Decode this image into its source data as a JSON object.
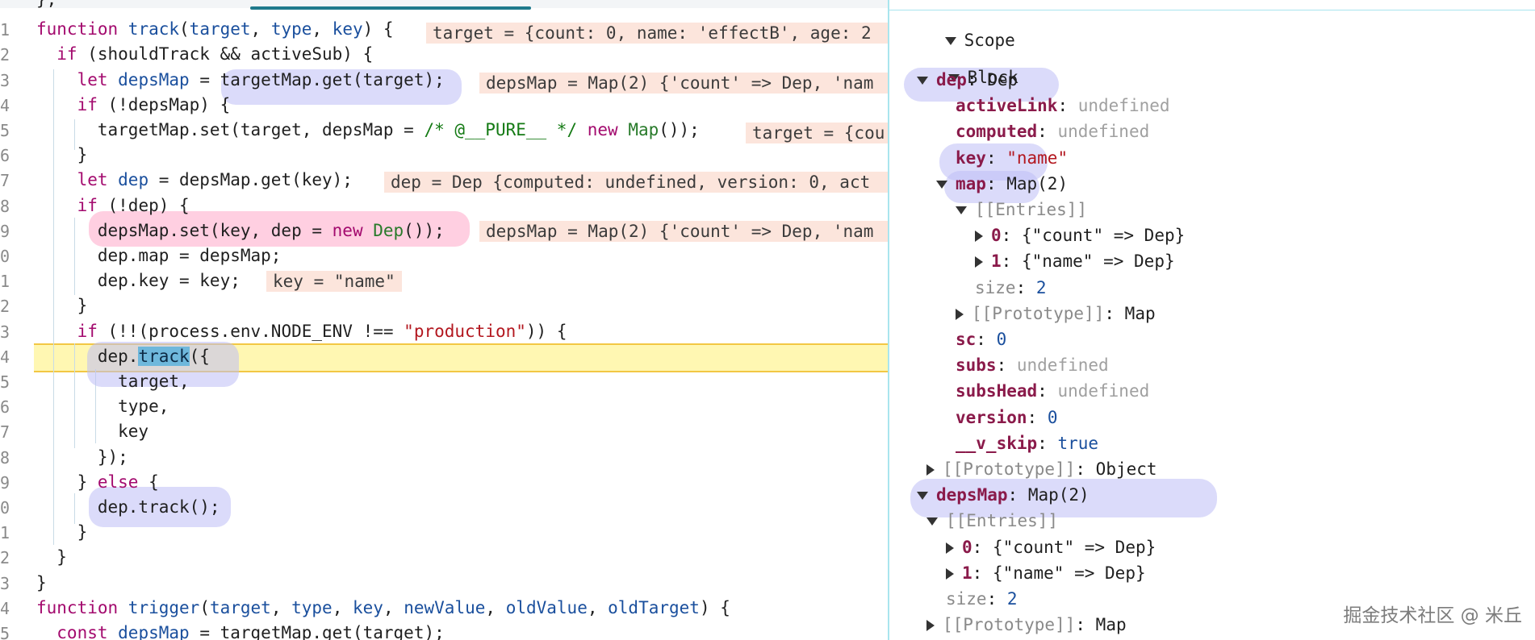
{
  "editor": {
    "gutter": [
      "1",
      "2",
      "3",
      "4",
      "5",
      "6",
      "7",
      "8",
      "9",
      "0",
      "1",
      "2",
      "3",
      "4",
      "5",
      "6",
      "7",
      "8",
      "9",
      "0",
      "1",
      "2",
      "3",
      "4",
      "5"
    ],
    "lines": [
      {
        "top": "",
        "segments": []
      },
      {
        "segments": [
          {
            "t": "function ",
            "c": "kw"
          },
          {
            "t": "track",
            "c": "fn"
          },
          {
            "t": "(",
            "c": ""
          },
          {
            "t": "target",
            "c": "fn"
          },
          {
            "t": ", ",
            "c": ""
          },
          {
            "t": "type",
            "c": "fn"
          },
          {
            "t": ", ",
            "c": ""
          },
          {
            "t": "key",
            "c": "fn"
          },
          {
            "t": ") {",
            "c": ""
          }
        ]
      },
      {
        "segments": [
          {
            "t": "  if ",
            "c": "kw"
          },
          {
            "t": "(shouldTrack && activeSub) {",
            "c": ""
          }
        ]
      },
      {
        "segments": [
          {
            "t": "    let ",
            "c": "kw"
          },
          {
            "t": "depsMap",
            "c": "fn"
          },
          {
            "t": " = targetMap.get(target);",
            "c": ""
          }
        ]
      },
      {
        "segments": [
          {
            "t": "    if ",
            "c": "kw"
          },
          {
            "t": "(!depsMap) {",
            "c": ""
          }
        ]
      },
      {
        "segments": [
          {
            "t": "      targetMap.set(target, depsMap = ",
            "c": ""
          },
          {
            "t": "/* @__PURE__ */",
            "c": "cmt"
          },
          {
            "t": " new ",
            "c": "kw"
          },
          {
            "t": "Map",
            "c": "cls"
          },
          {
            "t": "());",
            "c": ""
          }
        ]
      },
      {
        "segments": [
          {
            "t": "    }",
            "c": ""
          }
        ]
      },
      {
        "segments": [
          {
            "t": "    let ",
            "c": "kw"
          },
          {
            "t": "dep",
            "c": "fn"
          },
          {
            "t": " = depsMap.get(key);",
            "c": ""
          }
        ]
      },
      {
        "segments": [
          {
            "t": "    if ",
            "c": "kw"
          },
          {
            "t": "(!dep) {",
            "c": ""
          }
        ]
      },
      {
        "segments": [
          {
            "t": "      depsMap.set(key, dep = ",
            "c": ""
          },
          {
            "t": "new ",
            "c": "kw"
          },
          {
            "t": "Dep",
            "c": "cls"
          },
          {
            "t": "());",
            "c": ""
          }
        ]
      },
      {
        "segments": [
          {
            "t": "      dep.map = depsMap;",
            "c": ""
          }
        ]
      },
      {
        "segments": [
          {
            "t": "      dep.key = key;",
            "c": ""
          }
        ]
      },
      {
        "segments": [
          {
            "t": "    }",
            "c": ""
          }
        ]
      },
      {
        "segments": [
          {
            "t": "    if ",
            "c": "kw"
          },
          {
            "t": "(!!(process.env.NODE_ENV !== ",
            "c": ""
          },
          {
            "t": "\"production\"",
            "c": "str"
          },
          {
            "t": ")) {",
            "c": ""
          }
        ]
      },
      {
        "segments": [
          {
            "t": "      dep.",
            "c": ""
          },
          {
            "t": "track",
            "c": "sel"
          },
          {
            "t": "({",
            "c": ""
          }
        ]
      },
      {
        "segments": [
          {
            "t": "        target,",
            "c": ""
          }
        ]
      },
      {
        "segments": [
          {
            "t": "        type,",
            "c": ""
          }
        ]
      },
      {
        "segments": [
          {
            "t": "        key",
            "c": ""
          }
        ]
      },
      {
        "segments": [
          {
            "t": "      });",
            "c": ""
          }
        ]
      },
      {
        "segments": [
          {
            "t": "    } ",
            "c": ""
          },
          {
            "t": "else ",
            "c": "kw"
          },
          {
            "t": "{",
            "c": ""
          }
        ]
      },
      {
        "segments": [
          {
            "t": "      dep.track();",
            "c": ""
          }
        ]
      },
      {
        "segments": [
          {
            "t": "    }",
            "c": ""
          }
        ]
      },
      {
        "segments": [
          {
            "t": "  }",
            "c": ""
          }
        ]
      },
      {
        "segments": [
          {
            "t": "}",
            "c": ""
          }
        ]
      },
      {
        "segments": [
          {
            "t": "function ",
            "c": "kw"
          },
          {
            "t": "trigger",
            "c": "fn"
          },
          {
            "t": "(",
            "c": ""
          },
          {
            "t": "target",
            "c": "fn"
          },
          {
            "t": ", ",
            "c": ""
          },
          {
            "t": "type",
            "c": "fn"
          },
          {
            "t": ", ",
            "c": ""
          },
          {
            "t": "key",
            "c": "fn"
          },
          {
            "t": ", ",
            "c": ""
          },
          {
            "t": "newValue",
            "c": "fn"
          },
          {
            "t": ", ",
            "c": ""
          },
          {
            "t": "oldValue",
            "c": "fn"
          },
          {
            "t": ", ",
            "c": ""
          },
          {
            "t": "oldTarget",
            "c": "fn"
          },
          {
            "t": ") {",
            "c": ""
          }
        ]
      },
      {
        "segments": [
          {
            "t": "  const ",
            "c": "kw"
          },
          {
            "t": "depsMap",
            "c": "fn"
          },
          {
            "t": " = targetMap.get(target);",
            "c": ""
          }
        ]
      }
    ],
    "first_line_text": "},",
    "inline_values": {
      "line1": "target = {count: 0, name: 'effectB', age: 2",
      "line3": "depsMap = Map(2) {'count' => Dep, 'nam",
      "line5": "target = {cou",
      "line7": "dep = Dep {computed: undefined, version: 0, act",
      "line9": "depsMap = Map(2) {'count' => Dep, 'nam",
      "line11": "key = \"name\""
    }
  },
  "scope": {
    "title": "Scope",
    "block": "Block",
    "rows": [
      {
        "id": "dep",
        "depth": 1,
        "tri": "down",
        "key": "dep",
        "sep": ": ",
        "val": "Dep",
        "vc": "pval"
      },
      {
        "id": "activeLink",
        "depth": 2,
        "tri": "",
        "key": "activeLink",
        "sep": ": ",
        "val": "undefined",
        "vc": "pundef"
      },
      {
        "id": "computed",
        "depth": 2,
        "tri": "",
        "key": "computed",
        "sep": ": ",
        "val": "undefined",
        "vc": "pundef"
      },
      {
        "id": "key",
        "depth": 2,
        "tri": "",
        "key": "key",
        "sep": ": ",
        "val": "\"name\"",
        "vc": "pstr"
      },
      {
        "id": "map",
        "depth": 2,
        "tri": "down",
        "key": "map",
        "sep": ": ",
        "val": "Map(2)",
        "vc": "pval"
      },
      {
        "id": "entries1",
        "depth": 3,
        "tri": "down",
        "key": "[[Entries]]",
        "sep": "",
        "val": "",
        "vc": "pval",
        "kc": "pint"
      },
      {
        "id": "e0",
        "depth": 4,
        "tri": "right",
        "key": "0",
        "sep": ": ",
        "val": "{\"count\" => Dep}",
        "vc": "pval"
      },
      {
        "id": "e1",
        "depth": 4,
        "tri": "right",
        "key": "1",
        "sep": ": ",
        "val": "{\"name\" => Dep}",
        "vc": "pval"
      },
      {
        "id": "size1",
        "depth": 3,
        "tri": "",
        "key": "size",
        "sep": ": ",
        "val": "2",
        "vc": "pnum",
        "kc": "pint"
      },
      {
        "id": "proto1",
        "depth": 3,
        "tri": "right",
        "key": "[[Prototype]]",
        "sep": ": ",
        "val": "Map",
        "vc": "pval",
        "kc": "pint"
      },
      {
        "id": "sc",
        "depth": 2,
        "tri": "",
        "key": "sc",
        "sep": ": ",
        "val": "0",
        "vc": "pnum"
      },
      {
        "id": "subs",
        "depth": 2,
        "tri": "",
        "key": "subs",
        "sep": ": ",
        "val": "undefined",
        "vc": "pundef"
      },
      {
        "id": "subsHead",
        "depth": 2,
        "tri": "",
        "key": "subsHead",
        "sep": ": ",
        "val": "undefined",
        "vc": "pundef"
      },
      {
        "id": "version",
        "depth": 2,
        "tri": "",
        "key": "version",
        "sep": ": ",
        "val": "0",
        "vc": "pnum"
      },
      {
        "id": "vskip",
        "depth": 2,
        "tri": "",
        "key": "__v_skip",
        "sep": ": ",
        "val": "true",
        "vc": "pbool"
      },
      {
        "id": "proto2",
        "depth": 1.5,
        "tri": "right",
        "key": "[[Prototype]]",
        "sep": ": ",
        "val": "Object",
        "vc": "pval",
        "kc": "pint"
      },
      {
        "id": "depsMap",
        "depth": 1,
        "tri": "down",
        "key": "depsMap",
        "sep": ": ",
        "val": "Map(2)",
        "vc": "pval"
      },
      {
        "id": "entries2",
        "depth": 1.5,
        "tri": "down",
        "key": "[[Entries]]",
        "sep": "",
        "val": "",
        "vc": "pval",
        "kc": "pint"
      },
      {
        "id": "f0",
        "depth": 2.5,
        "tri": "right",
        "key": "0",
        "sep": ": ",
        "val": "{\"count\" => Dep}",
        "vc": "pval"
      },
      {
        "id": "f1",
        "depth": 2.5,
        "tri": "right",
        "key": "1",
        "sep": ": ",
        "val": "{\"name\" => Dep}",
        "vc": "pval"
      },
      {
        "id": "size2",
        "depth": 1.5,
        "tri": "",
        "key": "size",
        "sep": ": ",
        "val": "2",
        "vc": "pnum",
        "kc": "pint"
      },
      {
        "id": "proto3",
        "depth": 1.5,
        "tri": "right",
        "key": "[[Prototype]]",
        "sep": ": ",
        "val": "Map",
        "vc": "pval",
        "kc": "pint"
      }
    ]
  },
  "watermark": "掘金技术社区 @ 米丘"
}
